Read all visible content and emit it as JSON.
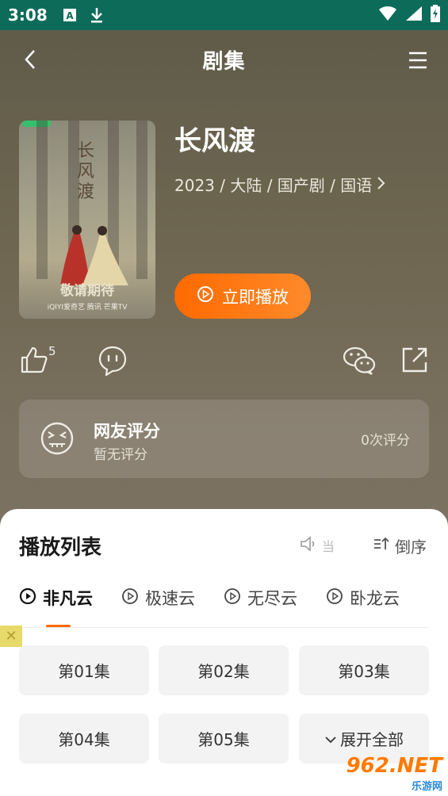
{
  "status_bar": {
    "time": "3:08",
    "icons": [
      "a-icon",
      "download-icon",
      "wifi-icon",
      "signal-icon",
      "battery-icon"
    ]
  },
  "header": {
    "title": "剧集"
  },
  "show": {
    "title": "长风渡",
    "meta": "2023 / 大陆 / 国产剧 / 国语",
    "play_label": "立即播放",
    "poster": {
      "calligraphy": "长风渡",
      "coming": "敬请期待",
      "brands": "iQIYI爱奇艺  腾讯  芒果TV"
    }
  },
  "actions": {
    "like_count": "5"
  },
  "rating": {
    "title": "网友评分",
    "subtitle": "暂无评分",
    "count": "0次评分"
  },
  "playlist": {
    "title": "播放列表",
    "speaker_text": "当",
    "order_label": "倒序",
    "sources": [
      "非凡云",
      "极速云",
      "无尽云",
      "卧龙云"
    ],
    "episodes": [
      "第01集",
      "第02集",
      "第03集",
      "第04集",
      "第05集"
    ],
    "expand_label": "展开全部"
  },
  "watermark": {
    "brand": "962.NET",
    "sub": "乐游网"
  },
  "colors": {
    "accent": "#ff6a00",
    "statusbar": "#0d6b5a"
  }
}
